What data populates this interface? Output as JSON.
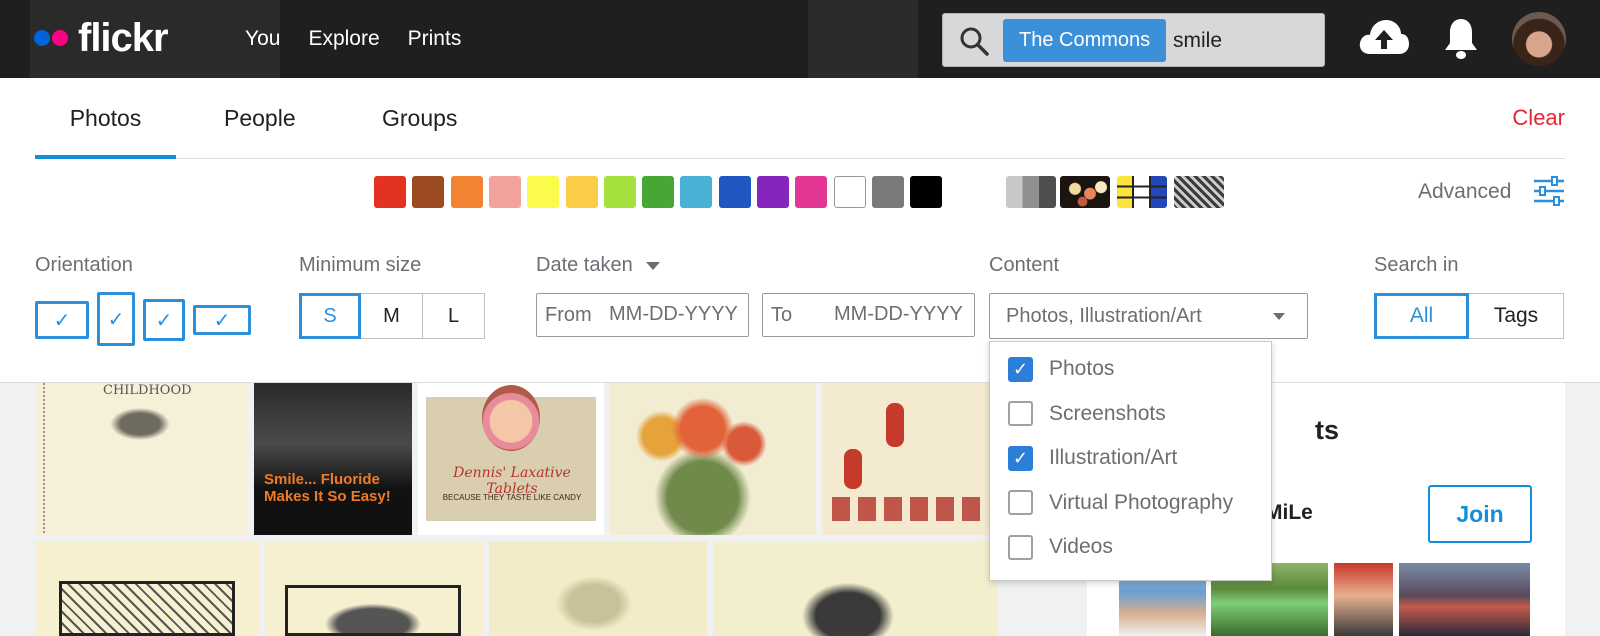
{
  "brand": {
    "name": "flickr"
  },
  "nav": {
    "you": "You",
    "explore": "Explore",
    "prints": "Prints"
  },
  "search": {
    "scope_chip": "The Commons",
    "query": "smile"
  },
  "tabs": {
    "photos": "Photos",
    "people": "People",
    "groups": "Groups"
  },
  "clear_label": "Clear",
  "colors": [
    "#e3321f",
    "#9c4a1f",
    "#f08432",
    "#f2a39c",
    "#fbfb4b",
    "#fbcd46",
    "#a5e03c",
    "#46a734",
    "#4ab1d6",
    "#2157c0",
    "#8625bd",
    "#e33796",
    "#ffffff",
    "#7a7a7a",
    "#000000"
  ],
  "advanced_label": "Advanced",
  "filters": {
    "orientation": {
      "label": "Orientation",
      "check": "✓"
    },
    "min_size": {
      "label": "Minimum size",
      "options": [
        "S",
        "M",
        "L"
      ],
      "selected": "S"
    },
    "date_taken": {
      "label": "Date taken",
      "from_label": "From",
      "to_label": "To",
      "placeholder": "MM-DD-YYYY"
    },
    "content": {
      "label": "Content",
      "value": "Photos, Illustration/Art"
    },
    "search_in": {
      "label": "Search in",
      "options": [
        "All",
        "Tags"
      ],
      "selected": "All"
    }
  },
  "content_options": [
    {
      "label": "Photos",
      "checked": true
    },
    {
      "label": "Screenshots",
      "checked": false
    },
    {
      "label": "Illustration/Art",
      "checked": true
    },
    {
      "label": "Virtual Photography",
      "checked": false
    },
    {
      "label": "Videos",
      "checked": false
    }
  ],
  "photos": {
    "childhood_caption": "CHILDHOOD",
    "fluoride_text": "Smile... Fluoride Makes It So Easy!",
    "laxative_text": "Dennis' Laxative Tablets",
    "laxative_sub": "BECAUSE THEY TASTE LIKE CANDY"
  },
  "sidebar": {
    "title_fragment": "ts",
    "group_name_fragment": "MiLe",
    "join_label": "Join"
  }
}
